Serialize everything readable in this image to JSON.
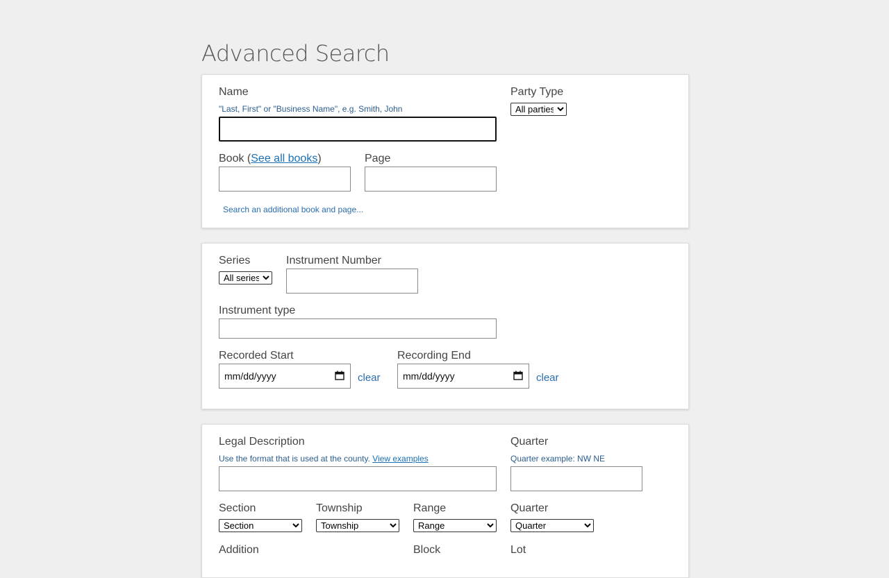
{
  "page": {
    "title": "Advanced Search"
  },
  "name_section": {
    "name_label": "Name",
    "name_hint": "\"Last, First\" or \"Business Name\", e.g. Smith, John",
    "name_value": "",
    "party_type_label": "Party Type",
    "party_type_options": [
      "All parties"
    ],
    "party_type_selected": "All parties",
    "book_label_prefix": "Book (",
    "book_link": "See all books",
    "book_label_suffix": ")",
    "book_value": "",
    "page_label": "Page",
    "page_value": "",
    "additional_book_link": "Search an additional book and page..."
  },
  "instrument_section": {
    "series_label": "Series",
    "series_options": [
      "All series"
    ],
    "series_selected": "All series",
    "instrument_number_label": "Instrument Number",
    "instrument_number_value": "",
    "instrument_type_label": "Instrument type",
    "instrument_type_value": "",
    "recorded_start_label": "Recorded Start",
    "recorded_start_placeholder": "mm/dd/yyyy",
    "recorded_start_clear": "clear",
    "recording_end_label": "Recording End",
    "recording_end_placeholder": "mm/dd/yyyy",
    "recording_end_clear": "clear",
    "calendar_icon": "calendar-icon"
  },
  "legal_section": {
    "legal_description_label": "Legal Description",
    "legal_description_hint": "Use the format that is used at the county.",
    "legal_description_link": "View examples",
    "legal_description_value": "",
    "quarter_label": "Quarter",
    "quarter_hint": "Quarter example: NW NE",
    "quarter_value": "",
    "section_label": "Section",
    "section_options": [
      "Section"
    ],
    "section_selected": "Section",
    "township_label": "Township",
    "township_options": [
      "Township"
    ],
    "township_selected": "Township",
    "range_label": "Range",
    "range_options": [
      "Range"
    ],
    "range_selected": "Range",
    "quarter2_label": "Quarter",
    "quarter2_options": [
      "Quarter"
    ],
    "quarter2_selected": "Quarter",
    "addition_label": "Addition",
    "block_label": "Block",
    "lot_label": "Lot"
  }
}
